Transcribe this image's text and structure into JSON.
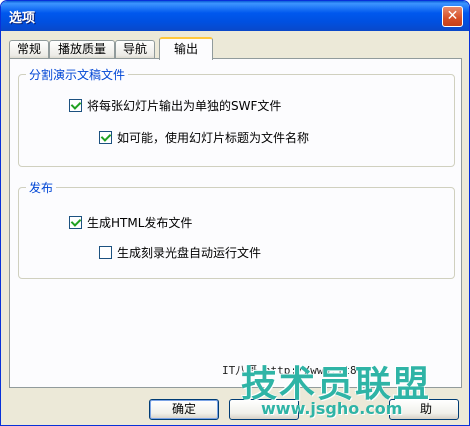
{
  "window": {
    "title": "选项",
    "close_glyph": "✕"
  },
  "tabs": [
    {
      "label": "常规"
    },
    {
      "label": "播放质量"
    },
    {
      "label": "导航"
    },
    {
      "label": "输出"
    }
  ],
  "groups": {
    "split": {
      "legend": "分割演示文稿文件",
      "items": [
        {
          "label": "将每张幻灯片输出为单独的SWF文件",
          "checked": true
        },
        {
          "label": "如可能，使用幻灯片标题为文件名称",
          "checked": true
        }
      ]
    },
    "publish": {
      "legend": "发布",
      "items": [
        {
          "label": "生成HTML发布文件",
          "checked": true
        },
        {
          "label": "生成刻录光盘自动运行文件",
          "checked": false
        }
      ]
    }
  },
  "watermark": {
    "small": "IT八哥 http://www.it8g...",
    "brand": "技术员联盟",
    "url": "www.jsgho.com"
  },
  "buttons": {
    "ok": "确定",
    "cancel_tail": "助"
  }
}
